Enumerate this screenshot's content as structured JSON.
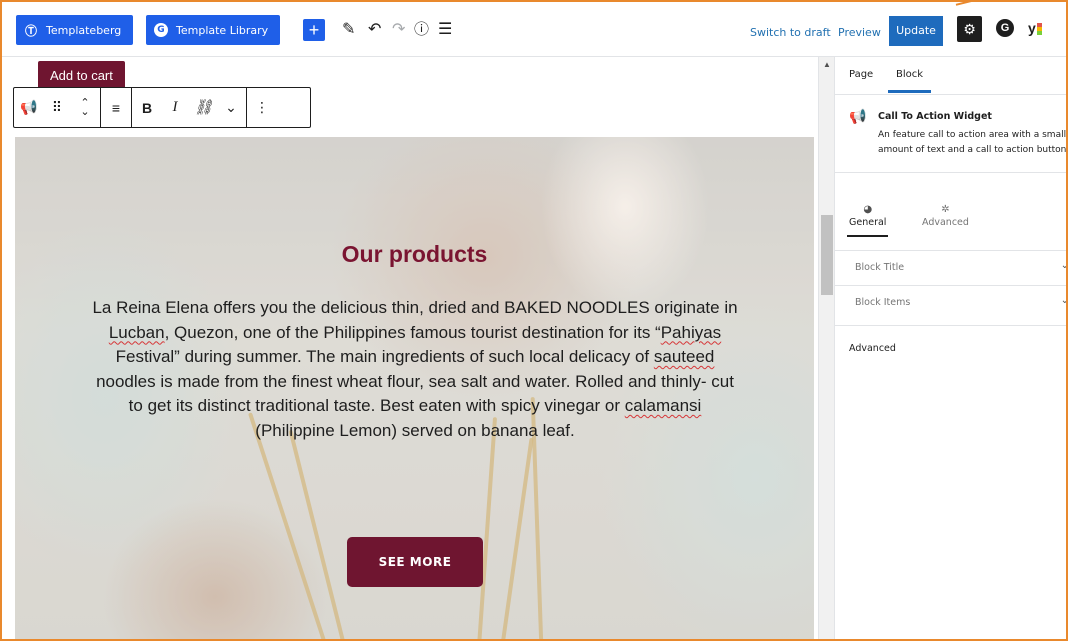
{
  "toolbar": {
    "templateberg_label": "Templateberg",
    "template_library_label": "Template Library",
    "add_block_symbol": "+",
    "switch_to_draft_label": "Switch to draft",
    "preview_label": "Preview",
    "update_label": "Update",
    "yoast_label": "y"
  },
  "block_toolbar": {
    "tooltip": "Add to cart",
    "bold_label": "B",
    "italic_label": "I"
  },
  "hero": {
    "title": "Our products",
    "text_segments": [
      "La Reina Elena offers you the delicious thin, dried and BAKED NOODLES originate in ",
      "Lucban",
      ", Quezon, one of the Philippines famous tourist destination for its “",
      "Pahiyas",
      " Festival” during summer. The main ingredients of such local delicacy of ",
      "sauteed",
      " noodles is made from the finest wheat flour, sea salt and water. Rolled and thinly- cut to get its distinct traditional taste. Best eaten with spicy vinegar or ",
      "calamansi",
      " (Philippine Lemon) served on banana leaf."
    ],
    "button_label": "SEE MORE"
  },
  "sidebar": {
    "tabs": [
      "Page",
      "Block"
    ],
    "active_tab": "Block",
    "block_name": "Call To Action Widget",
    "block_description_line1": "An feature call to action area with a small",
    "block_description_line2": "amount of text and a call to action button",
    "subtabs": [
      "General",
      "Advanced"
    ],
    "panels": [
      "Block Title",
      "Block Items"
    ],
    "advanced_title": "Advanced"
  },
  "colors": {
    "accent": "#1f5fe8",
    "update": "#1e6bbd",
    "brand_maroon": "#6f1530",
    "title_maroon": "#7a1431",
    "annotation_orange": "#e9892d"
  }
}
